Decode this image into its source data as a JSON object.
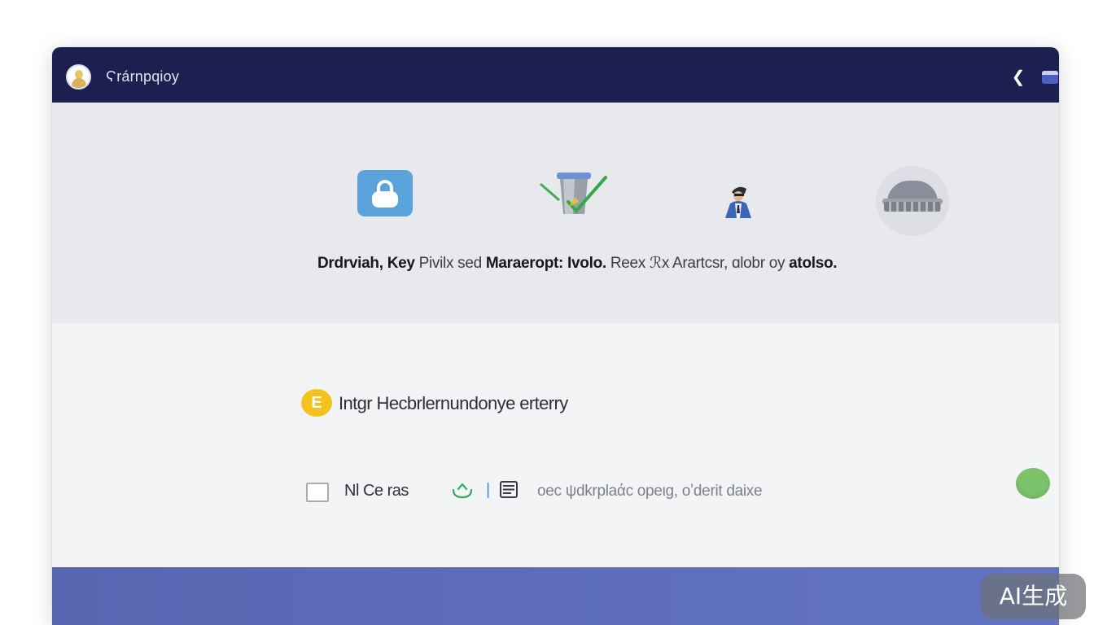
{
  "window": {
    "title": "Ϛrárnpqioy"
  },
  "hero": {
    "caption_bold_1": "Drdrviah, Key",
    "caption_light_1": " Pivilx sed ",
    "caption_bold_2": "Maraeropt: Ivolo.",
    "caption_light_2": " Reex ℛx Arartcsr, ɑlobr oy ",
    "caption_bold_3": "atolso."
  },
  "main": {
    "entry_icon_glyph": "E",
    "entry_label": "Intgr Hecbrlernundonye erterry",
    "option_label": "Nl Ce ras",
    "option_separator": "|",
    "option_description": "oec ψdkrplaάc opeιg, oʼderit daixe"
  },
  "watermark": {
    "text": "AI生成"
  },
  "colors": {
    "titlebar": "#1b2050",
    "hero_bg": "#e8e9ed",
    "main_bg": "#f3f4f6",
    "footer": "#5e6dbb",
    "entry_icon": "#f3c21d",
    "status_green": "#7cc26b",
    "lock_blue": "#5ba3dc"
  },
  "icons": {
    "app": "user-avatar-icon",
    "back": "chevron-left-icon",
    "panel": "panel-toggle-icon",
    "features": [
      "lock-icon",
      "trash-check-icon",
      "person-icon",
      "settings-dome-icon"
    ],
    "entry": "enter-icon",
    "share": "share-icon",
    "list": "list-icon",
    "status": "status-dot-icon"
  }
}
